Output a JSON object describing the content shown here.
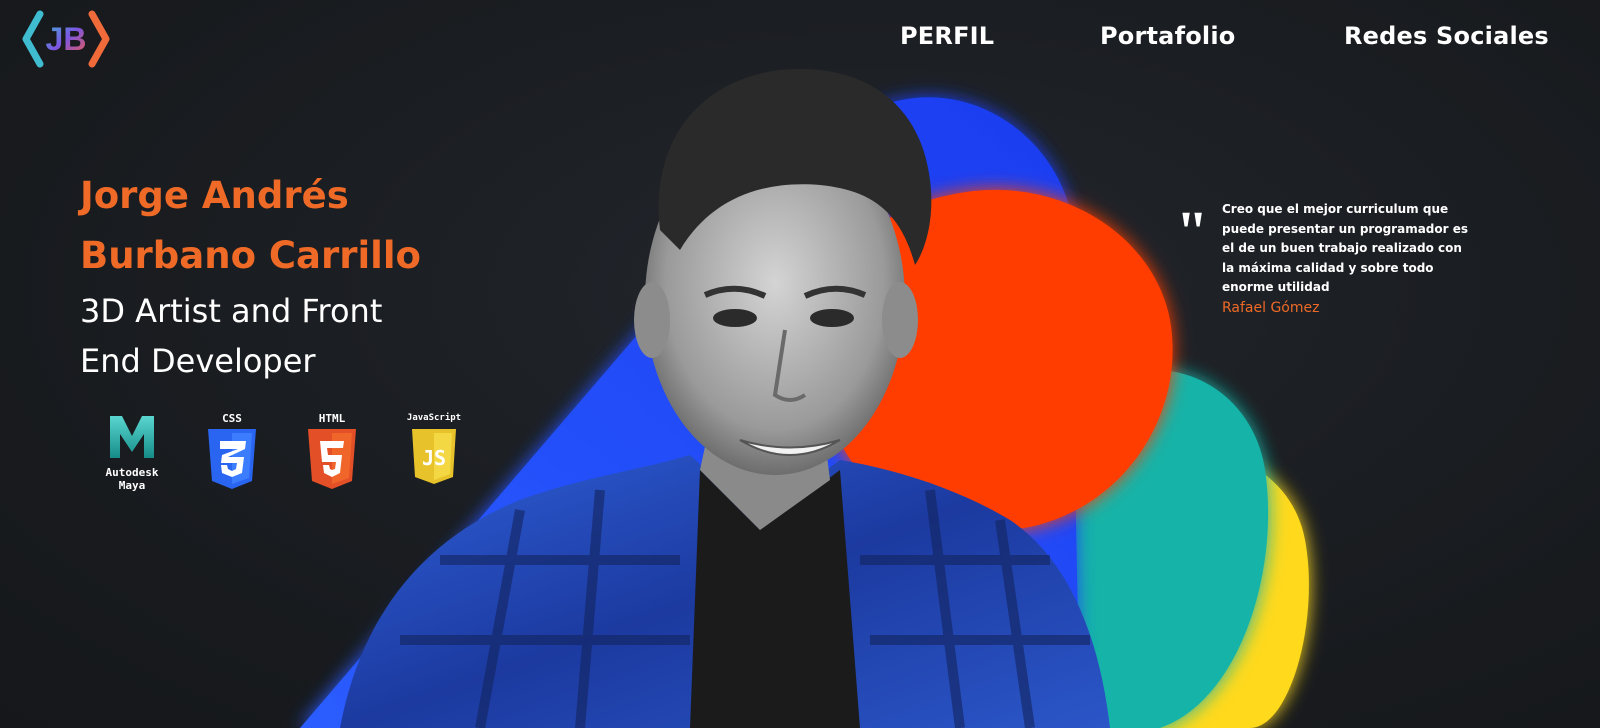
{
  "brand": {
    "logo_text": "JB"
  },
  "nav": {
    "items": [
      {
        "label": "PERFIL"
      },
      {
        "label": "Portafolio"
      },
      {
        "label": "Redes Sociales"
      }
    ]
  },
  "hero": {
    "name_line1": "Jorge Andrés",
    "name_line2": "Burbano Carrillo",
    "role_line1": "3D Artist and Front",
    "role_line2": "End Developer",
    "accent_color": "#ee6a26",
    "shape_colors": [
      "#1f4bff",
      "#ff3c00",
      "#13b4a8",
      "#ffd91a"
    ]
  },
  "technologies": [
    {
      "label": "Autodesk Maya",
      "label_line1": "Autodesk",
      "label_line2": "Maya",
      "icon": "maya-icon"
    },
    {
      "label": "CSS",
      "icon": "css3-icon"
    },
    {
      "label": "HTML",
      "icon": "html5-icon"
    },
    {
      "label": "JavaScript",
      "icon": "js-icon"
    }
  ],
  "quote": {
    "text": "Creo que el mejor curriculum que puede presentar un programador es el de un buen trabajo realizado con la máxima calidad y sobre todo enorme utilidad",
    "author": "Rafael Gómez"
  }
}
